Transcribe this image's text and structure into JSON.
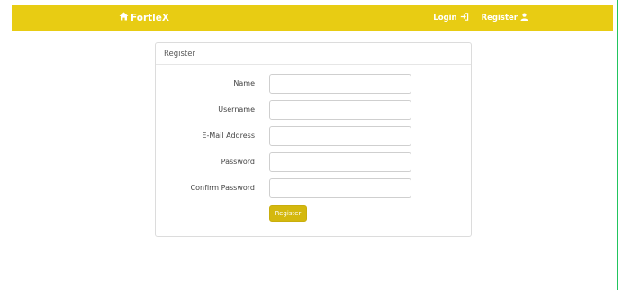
{
  "navbar": {
    "brand_label": "FortleX",
    "brand_icon": "home-icon",
    "login_label": "Login",
    "login_icon": "sign-in-icon",
    "register_label": "Register",
    "register_icon": "user-icon",
    "background_color": "#e8cc13"
  },
  "panel": {
    "heading": "Register",
    "fields": [
      {
        "label": "Name",
        "value": "",
        "placeholder": ""
      },
      {
        "label": "Username",
        "value": "",
        "placeholder": ""
      },
      {
        "label": "E-Mail Address",
        "value": "",
        "placeholder": ""
      },
      {
        "label": "Password",
        "value": "",
        "placeholder": ""
      },
      {
        "label": "Confirm Password",
        "value": "",
        "placeholder": ""
      }
    ],
    "submit_label": "Register",
    "submit_color": "#d4b80e"
  }
}
